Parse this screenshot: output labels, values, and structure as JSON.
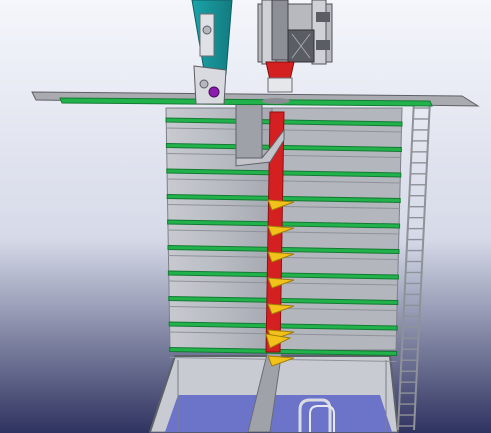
{
  "scene": {
    "colors": {
      "background_top": "#f4f6fb",
      "background_mid": "#d6dae8",
      "background_bottom": "#2f3360",
      "platform": "#a9abb1",
      "green_band": "#22b24c",
      "tower_panel": "#b9bcc3",
      "red_rod": "#d42020",
      "yellow_fin": "#f2c21a",
      "teal_arm": "#1e9aa0",
      "pit_water": "#6b74c9",
      "ladder": "#8f9298"
    },
    "components": [
      "top-platform",
      "crane-arm",
      "hoist-assembly",
      "stacked-tower",
      "central-rod",
      "ladder",
      "pit-frame"
    ]
  }
}
